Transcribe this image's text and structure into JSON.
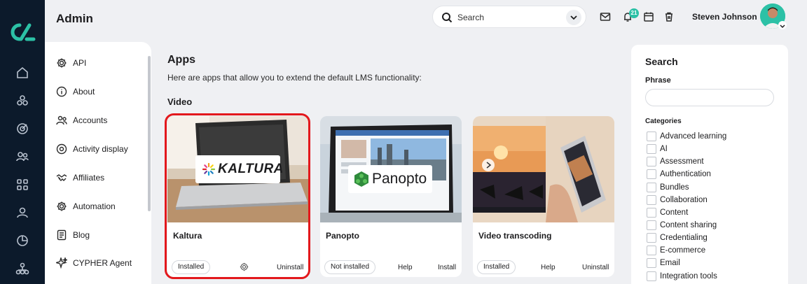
{
  "header": {
    "title": "Admin",
    "search_placeholder": "Search",
    "notification_count": "21",
    "user_name": "Steven Johnson"
  },
  "rail": {
    "icons": [
      "home-icon",
      "courses-icon",
      "target-icon",
      "users-group-icon",
      "apps-grid-icon",
      "user-icon",
      "reports-icon",
      "org-chart-icon"
    ]
  },
  "menu": {
    "items": [
      {
        "label": "API",
        "icon": "gear-icon"
      },
      {
        "label": "About",
        "icon": "info-icon"
      },
      {
        "label": "Accounts",
        "icon": "accounts-icon"
      },
      {
        "label": "Activity display",
        "icon": "activity-icon"
      },
      {
        "label": "Affiliates",
        "icon": "handshake-icon"
      },
      {
        "label": "Automation",
        "icon": "gear-icon"
      },
      {
        "label": "Blog",
        "icon": "blog-icon"
      },
      {
        "label": "CYPHER Agent",
        "icon": "sparkle-icon"
      }
    ]
  },
  "main": {
    "title": "Apps",
    "description": "Here are apps that allow you to extend the default LMS functionality:",
    "section": "Video",
    "cards": [
      {
        "name": "Kaltura",
        "status": "Installed",
        "actions": [
          "Uninstall"
        ],
        "logo_text": "KALTURA"
      },
      {
        "name": "Panopto",
        "status": "Not installed",
        "actions": [
          "Help",
          "Install"
        ],
        "logo_text": "Panopto"
      },
      {
        "name": "Video transcoding",
        "status": "Installed",
        "actions": [
          "Help",
          "Uninstall"
        ]
      }
    ]
  },
  "search_panel": {
    "title": "Search",
    "phrase_label": "Phrase",
    "phrase_value": "",
    "categories_label": "Categories",
    "categories": [
      "Advanced learning",
      "AI",
      "Assessment",
      "Authentication",
      "Bundles",
      "Collaboration",
      "Content",
      "Content sharing",
      "Credentialing",
      "E-commerce",
      "Email",
      "Integration tools"
    ]
  },
  "colors": {
    "rail": "#0c1a2b",
    "accent": "#2cc1a6",
    "highlight": "#e3181c"
  }
}
